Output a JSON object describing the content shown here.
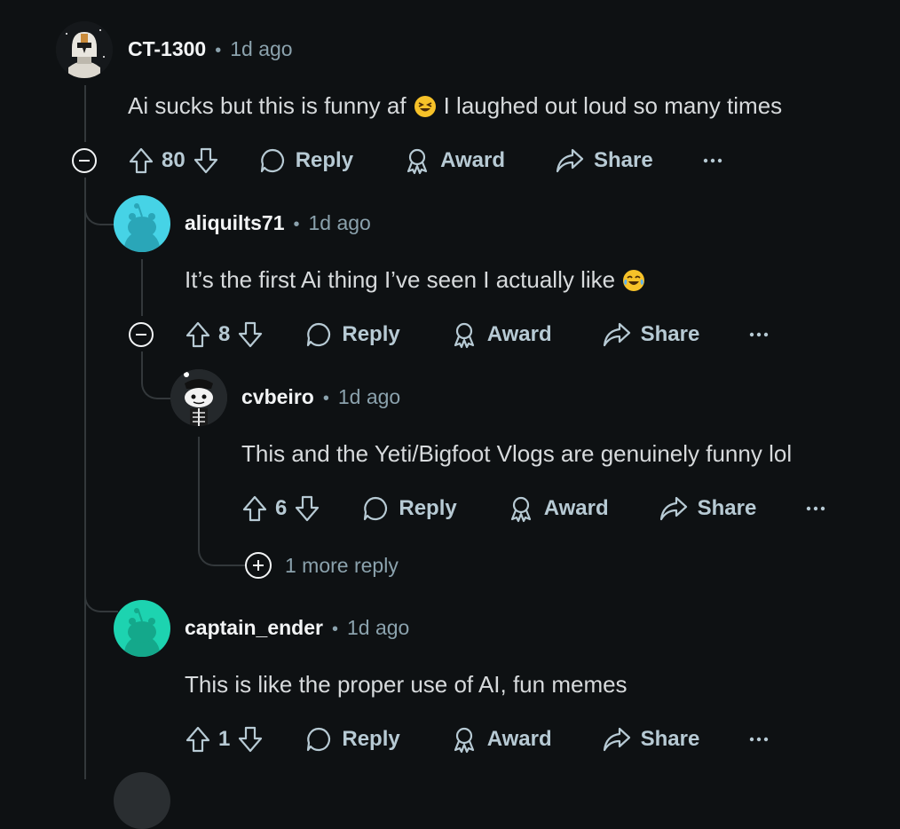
{
  "comments": [
    {
      "username": "CT-1300",
      "time": "1d ago",
      "text_before": "Ai sucks but this is funny af",
      "text_after": "I laughed out loud so many times",
      "emoji": "laughing-squint-emoji",
      "votes": "80",
      "reply_label": "Reply",
      "award_label": "Award",
      "share_label": "Share"
    },
    {
      "username": "aliquilts71",
      "time": "1d ago",
      "text_before": "It’s the first Ai thing I’ve seen I actually like",
      "emoji": "tears-of-joy-emoji",
      "votes": "8",
      "reply_label": "Reply",
      "award_label": "Award",
      "share_label": "Share"
    },
    {
      "username": "cvbeiro",
      "time": "1d ago",
      "text_before": "This and the Yeti/Bigfoot Vlogs are genuinely funny lol",
      "votes": "6",
      "reply_label": "Reply",
      "award_label": "Award",
      "share_label": "Share",
      "more_replies": "1 more reply"
    },
    {
      "username": "captain_ender",
      "time": "1d ago",
      "text_before": "This is like the proper use of AI, fun memes",
      "votes": "1",
      "reply_label": "Reply",
      "award_label": "Award",
      "share_label": "Share"
    }
  ],
  "separator": "•",
  "colors": {
    "background": "#0e1113",
    "text": "#d7dadc",
    "muted": "#8ba2ad",
    "thread_line": "#33383b",
    "avatar_cyan": "#46d3e6",
    "avatar_teal": "#1dd3b0"
  }
}
